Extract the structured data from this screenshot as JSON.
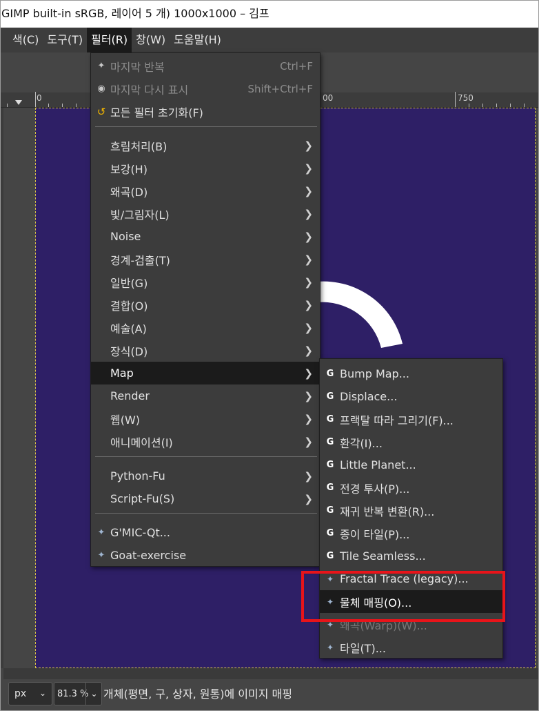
{
  "window": {
    "title": "GIMP built-in sRGB, 레이어 5 개) 1000x1000 – 김프"
  },
  "menubar": {
    "items": [
      {
        "label": "색(C)"
      },
      {
        "label": "도구(T)"
      },
      {
        "label": "필터(R)"
      },
      {
        "label": "창(W)"
      },
      {
        "label": "도움말(H)"
      }
    ]
  },
  "ruler": {
    "labels": [
      "0",
      "00",
      "750"
    ]
  },
  "filters_menu": {
    "repeat_last": {
      "label": "마지막 반복",
      "shortcut": "Ctrl+F"
    },
    "reshow_last": {
      "label": "마지막 다시 표시",
      "shortcut": "Shift+Ctrl+F"
    },
    "reset_all": {
      "label": "모든 필터 초기화(F)"
    },
    "items": [
      {
        "label": "흐림처리(B)"
      },
      {
        "label": "보강(H)"
      },
      {
        "label": "왜곡(D)"
      },
      {
        "label": "빛/그림자(L)"
      },
      {
        "label": "Noise"
      },
      {
        "label": "경계-검출(T)"
      },
      {
        "label": "일반(G)"
      },
      {
        "label": "결합(O)"
      },
      {
        "label": "예술(A)"
      },
      {
        "label": "장식(D)"
      },
      {
        "label": "Map"
      },
      {
        "label": "Render"
      },
      {
        "label": "웹(W)"
      },
      {
        "label": "애니메이션(I)"
      }
    ],
    "scripting": [
      {
        "label": "Python-Fu"
      },
      {
        "label": "Script-Fu(S)"
      }
    ],
    "plugins": [
      {
        "label": "G'MIC-Qt..."
      },
      {
        "label": "Goat-exercise"
      }
    ]
  },
  "map_submenu": {
    "items": [
      {
        "label": "Bump Map...",
        "icon": "gegl-icon"
      },
      {
        "label": "Displace...",
        "icon": "gegl-icon"
      },
      {
        "label": "프랙탈 따라 그리기(F)...",
        "icon": "gegl-icon"
      },
      {
        "label": "환각(I)...",
        "icon": "gegl-icon"
      },
      {
        "label": "Little Planet...",
        "icon": "gegl-icon"
      },
      {
        "label": "전경 투사(P)...",
        "icon": "gegl-icon"
      },
      {
        "label": "재귀 반복 변환(R)...",
        "icon": "gegl-icon"
      },
      {
        "label": "종이 타일(P)...",
        "icon": "gegl-icon"
      },
      {
        "label": "Tile Seamless...",
        "icon": "gegl-icon"
      },
      {
        "label": "Fractal Trace (legacy)...",
        "icon": "plugin-icon"
      },
      {
        "label": "물체 매핑(O)...",
        "icon": "plugin-icon"
      },
      {
        "label": "왜곡(Warp)(W)...",
        "icon": "plugin-icon"
      },
      {
        "label": "타일(T)...",
        "icon": "plugin-icon"
      }
    ]
  },
  "statusbar": {
    "unit": "px",
    "zoom": "81.3 %",
    "message": "개체(평면, 구, 상자, 원통)에 이미지 매핑"
  },
  "colors": {
    "canvas": "#2e1f66",
    "highlight_box": "#e8141a",
    "menu_bg": "#3c3c3c",
    "menu_highlight": "#1b1b1b"
  }
}
